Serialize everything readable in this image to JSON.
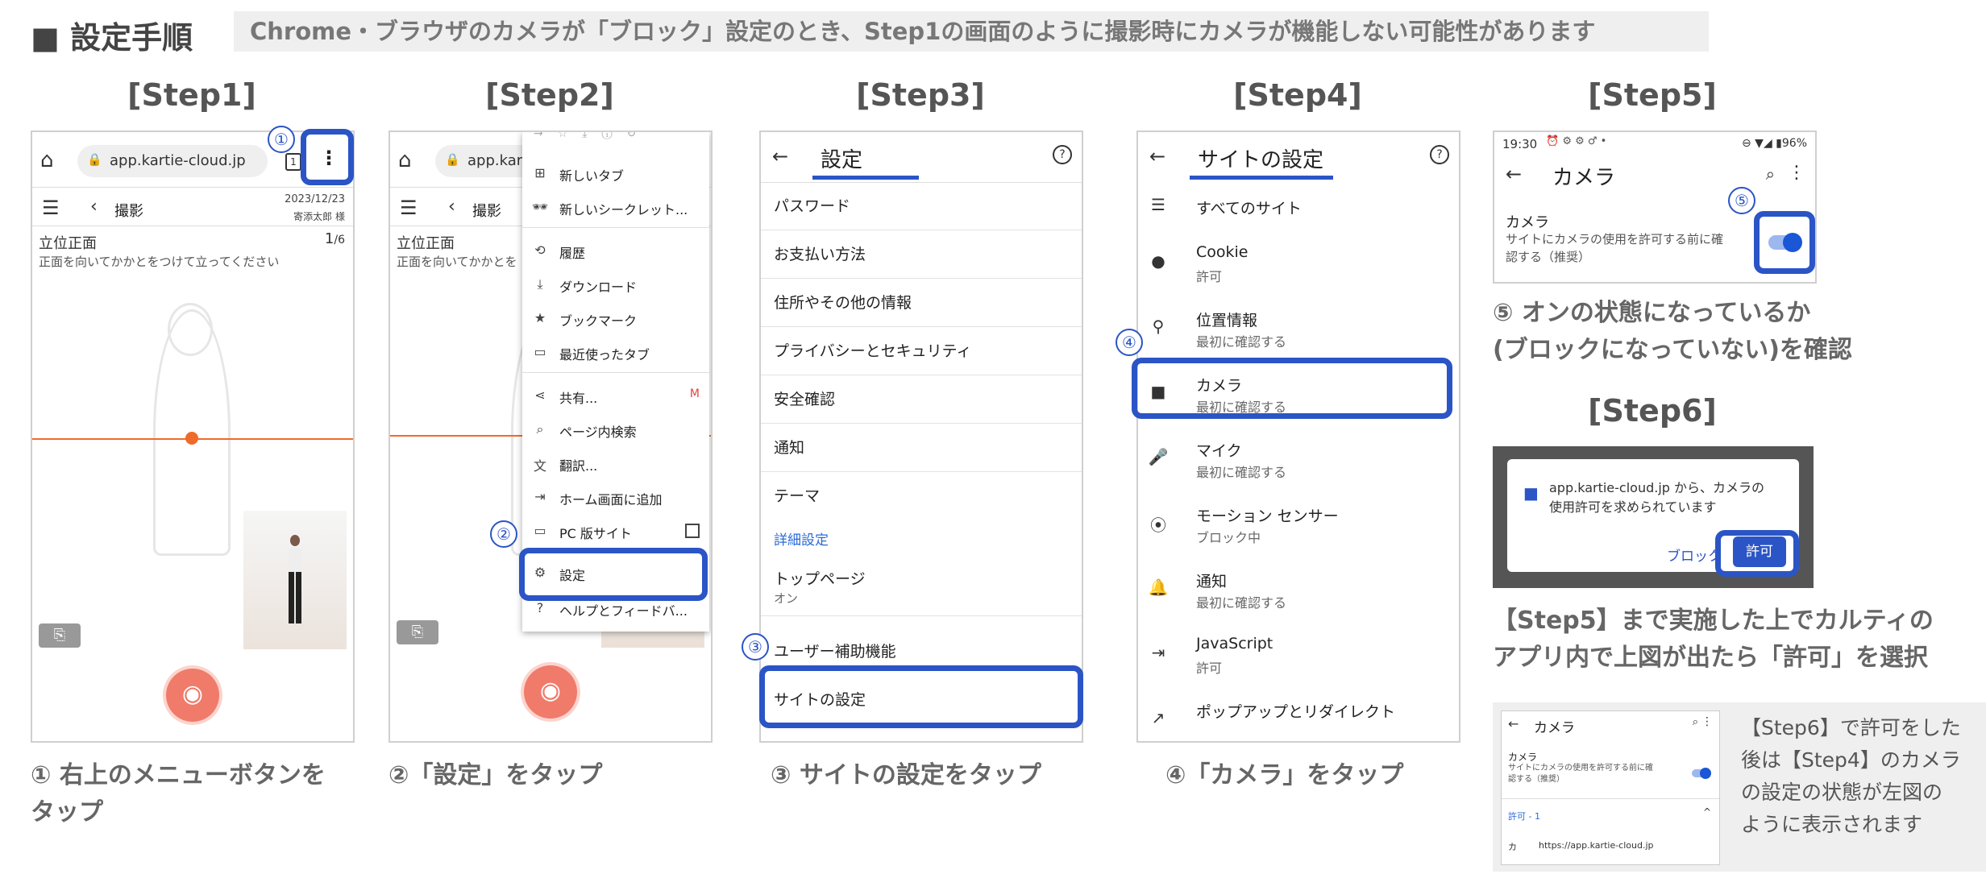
{
  "header": {
    "title": "■ 設定手順",
    "note": "Chrome・ブラウザのカメラが「ブロック」設定のとき、Step1の画面のように撮影時にカメラが機能しない可能性があります"
  },
  "steps": {
    "s1": "[Step1]",
    "s2": "[Step2]",
    "s3": "[Step3]",
    "s4": "[Step4]",
    "s5": "[Step5]",
    "s6": "[Step6]"
  },
  "badges": {
    "b1": "①",
    "b2": "②",
    "b3": "③",
    "b4": "④",
    "b5": "⑤"
  },
  "step1": {
    "url": "app.kartie-cloud.jp",
    "tab_count": "1",
    "nav_title": "撮影",
    "date": "2023/12/23",
    "user": "寄添太郎 様",
    "pose_title": "立位正面",
    "pose_counter": "1",
    "pose_total": "/6",
    "pose_desc": "正面を向いてかかとをつけて立ってください"
  },
  "step2": {
    "url": "app.kart",
    "nav_title": "撮影",
    "pose_title": "立位正面",
    "pose_desc": "正面を向いてかかとを",
    "menu": [
      "新しいタブ",
      "新しいシークレット...",
      "履歴",
      "ダウンロード",
      "ブックマーク",
      "最近使ったタブ",
      "共有...",
      "ページ内検索",
      "翻訳...",
      "ホーム画面に追加",
      "PC 版サイト",
      "設定",
      "ヘルプとフィードバ..."
    ]
  },
  "step3": {
    "title": "設定",
    "rows": [
      "パスワード",
      "お支払い方法",
      "住所やその他の情報",
      "プライバシーとセキュリティ",
      "安全確認",
      "通知",
      "テーマ"
    ],
    "section": "詳細設定",
    "top_page": "トップページ",
    "top_page_sub": "オン",
    "accessibility": "ユーザー補助機能",
    "site_settings": "サイトの設定"
  },
  "step4": {
    "title": "サイトの設定",
    "all_sites": "すべてのサイト",
    "rows": [
      {
        "t": "Cookie",
        "s": "許可"
      },
      {
        "t": "位置情報",
        "s": "最初に確認する"
      },
      {
        "t": "カメラ",
        "s": "最初に確認する"
      },
      {
        "t": "マイク",
        "s": "最初に確認する"
      },
      {
        "t": "モーション センサー",
        "s": "ブロック中"
      },
      {
        "t": "通知",
        "s": "最初に確認する"
      },
      {
        "t": "JavaScript",
        "s": "許可"
      },
      {
        "t": "ポップアップとリダイレクト",
        "s": ""
      }
    ]
  },
  "step5": {
    "time": "19:30",
    "battery": "96%",
    "title": "カメラ",
    "setting_name": "カメラ",
    "setting_desc1": "サイトにカメラの使用を許可する前に確",
    "setting_desc2": "認する（推奨）",
    "caption1": "⑤ オンの状態になっているか",
    "caption2": "(ブロックになっていない)を確認"
  },
  "step6": {
    "dialog1": "app.kartie-cloud.jp から、カメラの",
    "dialog2": "使用許可を求められています",
    "block": "ブロック",
    "allow": "許可",
    "caption1": "【Step5】まで実施した上でカルティの",
    "caption2": "アプリ内で上図が出たら「許可」を選択"
  },
  "thumb": {
    "title": "カメラ",
    "setting_name": "カメラ",
    "desc1": "サイトにカメラの使用を許可する前に確",
    "desc2": "認する（推奨）",
    "allowed": "許可 - 1",
    "site_icon": "カ",
    "site": "https://app.kartie-cloud.jp",
    "note1": "【Step6】で許可をした",
    "note2": "後は【Step4】のカメラ",
    "note3": "の設定の状態が左図の",
    "note4": "ように表示されます"
  },
  "captions": {
    "c1a": "① 右上のメニューボタンを",
    "c1b": "タップ",
    "c2": "②「設定」をタップ",
    "c3": "③ サイトの設定をタップ",
    "c4": "④「カメラ」をタップ"
  },
  "colors": {
    "accent": "#2b55c6",
    "shutter": "#f07b6b",
    "guide_line": "#f06a2a"
  }
}
